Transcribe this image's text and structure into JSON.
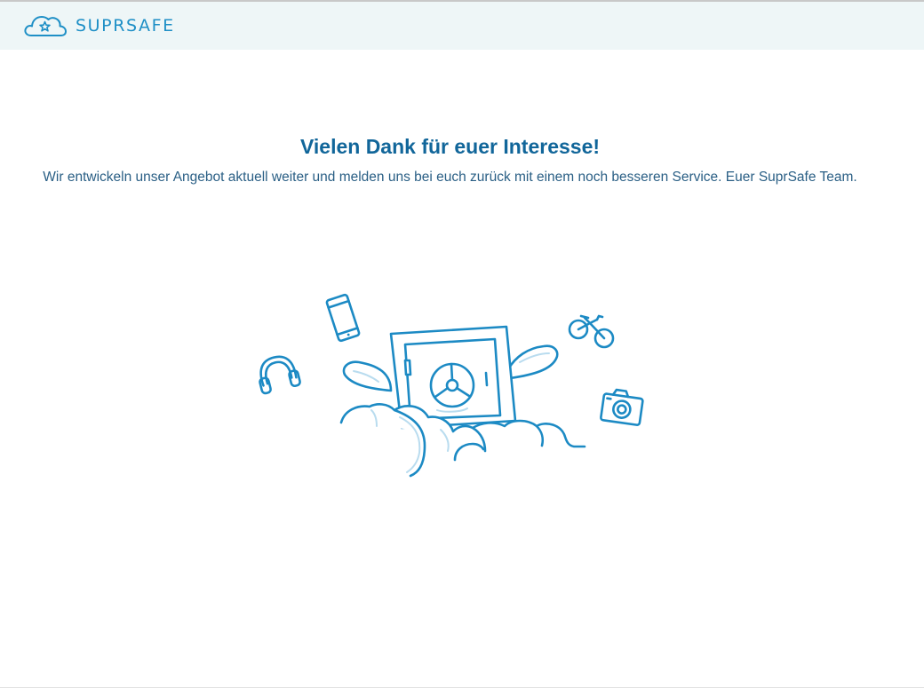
{
  "brand": {
    "name": "SUPRSAFE",
    "logo_icon": "cloud-star-icon",
    "color": "#1e8fc6"
  },
  "header": {
    "background": "#eef6f7"
  },
  "main": {
    "headline": "Vielen Dank für euer Interesse!",
    "message": "Wir entwickeln unser Angebot aktuell weiter und melden uns bei euch zurück mit einem noch besseren Service. Euer SuprSafe Team."
  },
  "illustration": {
    "icons": [
      "smartphone-icon",
      "headphones-icon",
      "winged-safe-icon",
      "bicycle-icon",
      "camera-icon",
      "clouds"
    ],
    "stroke_color": "#1c8ac4",
    "accent_color": "#b9dcef"
  }
}
